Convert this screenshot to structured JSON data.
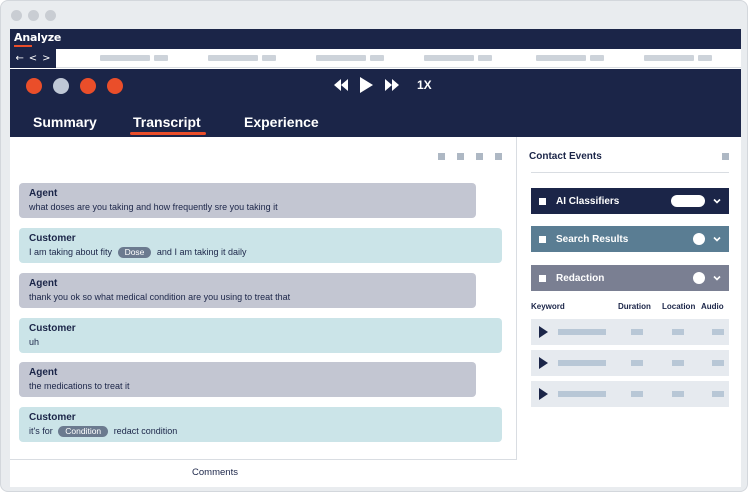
{
  "app": {
    "name": "Analyze"
  },
  "nav": {
    "back": "←",
    "prev": "<",
    "next": ">"
  },
  "player": {
    "status_circle_colors": [
      "#ea4e2a",
      "#bfc8d6",
      "#ea4e2a",
      "#ea4e2a"
    ],
    "speed": "1X"
  },
  "tabs": [
    {
      "label": "Summary",
      "active": false
    },
    {
      "label": "Transcript",
      "active": true
    },
    {
      "label": "Experience",
      "active": false
    }
  ],
  "transcript": [
    {
      "speaker": "Agent",
      "text": "what doses are you taking and how frequently sre you taking it"
    },
    {
      "speaker": "Customer",
      "before": "I am taking about fity",
      "tag": "Dose",
      "after": "and I am taking it daily"
    },
    {
      "speaker": "Agent",
      "text": "thank you ok so what medical condition are you using to treat that"
    },
    {
      "speaker": "Customer",
      "text": "uh"
    },
    {
      "speaker": "Agent",
      "text": "the medications to treat it"
    },
    {
      "speaker": "Customer",
      "before": "it's for",
      "tag": "Condition",
      "after": "redact condition"
    }
  ],
  "comments": {
    "label": "Comments"
  },
  "contact_events": {
    "title": "Contact Events",
    "sections": [
      {
        "label": "AI Classifiers",
        "color": "#1b2548"
      },
      {
        "label": "Search Results",
        "color": "#5a7d93"
      },
      {
        "label": "Redaction",
        "color": "#7a7f92"
      }
    ],
    "columns": [
      "Keyword",
      "Duration",
      "Location",
      "Audio"
    ]
  },
  "colors": {
    "navy": "#1b2548",
    "accent": "#ea4e2a",
    "agent_bubble": "#c3c6d2",
    "customer_bubble": "#cbe4e8"
  }
}
